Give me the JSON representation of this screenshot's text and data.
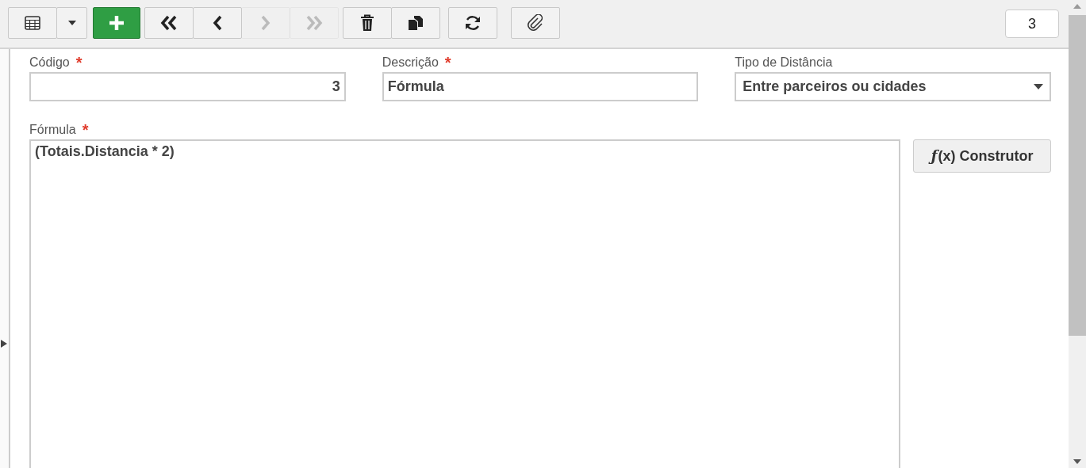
{
  "toolbar": {
    "groups": [
      {
        "buttons": [
          {
            "kind": "grid",
            "disabled": false
          },
          {
            "kind": "dropdown",
            "disabled": false
          }
        ]
      },
      {
        "buttons": [
          {
            "kind": "add",
            "disabled": false
          }
        ]
      },
      {
        "buttons": [
          {
            "kind": "first",
            "disabled": false
          },
          {
            "kind": "prev",
            "disabled": false
          },
          {
            "kind": "next",
            "disabled": true
          },
          {
            "kind": "last",
            "disabled": true
          }
        ]
      },
      {
        "buttons": [
          {
            "kind": "delete",
            "disabled": false
          },
          {
            "kind": "copy",
            "disabled": false
          }
        ]
      },
      {
        "buttons": [
          {
            "kind": "refresh",
            "disabled": false
          }
        ]
      },
      {
        "buttons": [
          {
            "kind": "attach",
            "disabled": false
          }
        ]
      }
    ],
    "record_badge": "3"
  },
  "fields": [
    {
      "kind": "number",
      "label": "Código",
      "required_mark": "*",
      "value": "3"
    },
    {
      "kind": "text",
      "label": "Descrição",
      "required_mark": "*",
      "value": "Fórmula"
    },
    {
      "kind": "select",
      "label": "Tipo de Distância",
      "value": "Entre parceiros ou cidades"
    }
  ],
  "formula": {
    "label": "Fórmula",
    "required_mark": "*",
    "value": "(Totais.Distancia * 2)",
    "builder_button": {
      "icon_text": "ƒ",
      "label": "(x) Construtor"
    }
  }
}
